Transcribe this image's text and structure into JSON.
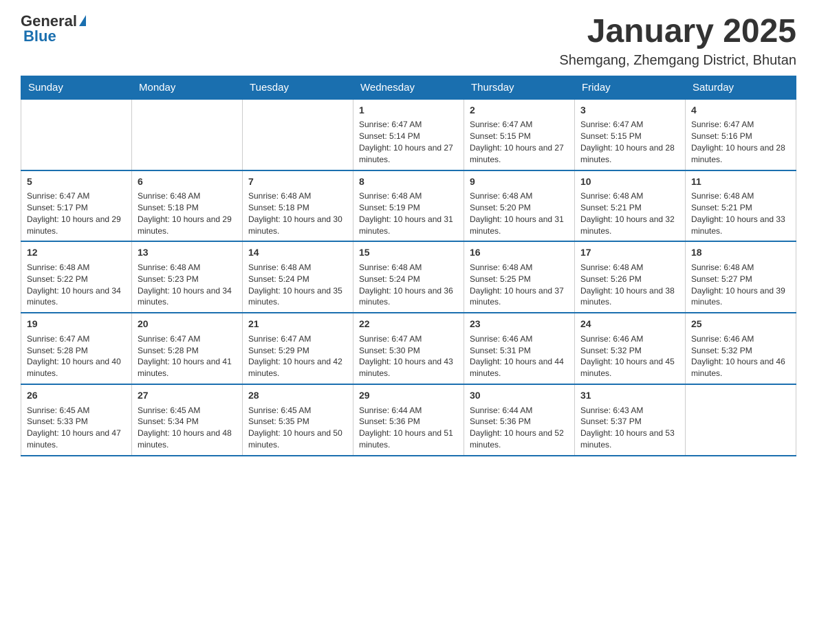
{
  "logo": {
    "text_general": "General",
    "text_blue": "Blue"
  },
  "title": "January 2025",
  "subtitle": "Shemgang, Zhemgang District, Bhutan",
  "days_of_week": [
    "Sunday",
    "Monday",
    "Tuesday",
    "Wednesday",
    "Thursday",
    "Friday",
    "Saturday"
  ],
  "weeks": [
    [
      {
        "day": "",
        "info": ""
      },
      {
        "day": "",
        "info": ""
      },
      {
        "day": "",
        "info": ""
      },
      {
        "day": "1",
        "info": "Sunrise: 6:47 AM\nSunset: 5:14 PM\nDaylight: 10 hours and 27 minutes."
      },
      {
        "day": "2",
        "info": "Sunrise: 6:47 AM\nSunset: 5:15 PM\nDaylight: 10 hours and 27 minutes."
      },
      {
        "day": "3",
        "info": "Sunrise: 6:47 AM\nSunset: 5:15 PM\nDaylight: 10 hours and 28 minutes."
      },
      {
        "day": "4",
        "info": "Sunrise: 6:47 AM\nSunset: 5:16 PM\nDaylight: 10 hours and 28 minutes."
      }
    ],
    [
      {
        "day": "5",
        "info": "Sunrise: 6:47 AM\nSunset: 5:17 PM\nDaylight: 10 hours and 29 minutes."
      },
      {
        "day": "6",
        "info": "Sunrise: 6:48 AM\nSunset: 5:18 PM\nDaylight: 10 hours and 29 minutes."
      },
      {
        "day": "7",
        "info": "Sunrise: 6:48 AM\nSunset: 5:18 PM\nDaylight: 10 hours and 30 minutes."
      },
      {
        "day": "8",
        "info": "Sunrise: 6:48 AM\nSunset: 5:19 PM\nDaylight: 10 hours and 31 minutes."
      },
      {
        "day": "9",
        "info": "Sunrise: 6:48 AM\nSunset: 5:20 PM\nDaylight: 10 hours and 31 minutes."
      },
      {
        "day": "10",
        "info": "Sunrise: 6:48 AM\nSunset: 5:21 PM\nDaylight: 10 hours and 32 minutes."
      },
      {
        "day": "11",
        "info": "Sunrise: 6:48 AM\nSunset: 5:21 PM\nDaylight: 10 hours and 33 minutes."
      }
    ],
    [
      {
        "day": "12",
        "info": "Sunrise: 6:48 AM\nSunset: 5:22 PM\nDaylight: 10 hours and 34 minutes."
      },
      {
        "day": "13",
        "info": "Sunrise: 6:48 AM\nSunset: 5:23 PM\nDaylight: 10 hours and 34 minutes."
      },
      {
        "day": "14",
        "info": "Sunrise: 6:48 AM\nSunset: 5:24 PM\nDaylight: 10 hours and 35 minutes."
      },
      {
        "day": "15",
        "info": "Sunrise: 6:48 AM\nSunset: 5:24 PM\nDaylight: 10 hours and 36 minutes."
      },
      {
        "day": "16",
        "info": "Sunrise: 6:48 AM\nSunset: 5:25 PM\nDaylight: 10 hours and 37 minutes."
      },
      {
        "day": "17",
        "info": "Sunrise: 6:48 AM\nSunset: 5:26 PM\nDaylight: 10 hours and 38 minutes."
      },
      {
        "day": "18",
        "info": "Sunrise: 6:48 AM\nSunset: 5:27 PM\nDaylight: 10 hours and 39 minutes."
      }
    ],
    [
      {
        "day": "19",
        "info": "Sunrise: 6:47 AM\nSunset: 5:28 PM\nDaylight: 10 hours and 40 minutes."
      },
      {
        "day": "20",
        "info": "Sunrise: 6:47 AM\nSunset: 5:28 PM\nDaylight: 10 hours and 41 minutes."
      },
      {
        "day": "21",
        "info": "Sunrise: 6:47 AM\nSunset: 5:29 PM\nDaylight: 10 hours and 42 minutes."
      },
      {
        "day": "22",
        "info": "Sunrise: 6:47 AM\nSunset: 5:30 PM\nDaylight: 10 hours and 43 minutes."
      },
      {
        "day": "23",
        "info": "Sunrise: 6:46 AM\nSunset: 5:31 PM\nDaylight: 10 hours and 44 minutes."
      },
      {
        "day": "24",
        "info": "Sunrise: 6:46 AM\nSunset: 5:32 PM\nDaylight: 10 hours and 45 minutes."
      },
      {
        "day": "25",
        "info": "Sunrise: 6:46 AM\nSunset: 5:32 PM\nDaylight: 10 hours and 46 minutes."
      }
    ],
    [
      {
        "day": "26",
        "info": "Sunrise: 6:45 AM\nSunset: 5:33 PM\nDaylight: 10 hours and 47 minutes."
      },
      {
        "day": "27",
        "info": "Sunrise: 6:45 AM\nSunset: 5:34 PM\nDaylight: 10 hours and 48 minutes."
      },
      {
        "day": "28",
        "info": "Sunrise: 6:45 AM\nSunset: 5:35 PM\nDaylight: 10 hours and 50 minutes."
      },
      {
        "day": "29",
        "info": "Sunrise: 6:44 AM\nSunset: 5:36 PM\nDaylight: 10 hours and 51 minutes."
      },
      {
        "day": "30",
        "info": "Sunrise: 6:44 AM\nSunset: 5:36 PM\nDaylight: 10 hours and 52 minutes."
      },
      {
        "day": "31",
        "info": "Sunrise: 6:43 AM\nSunset: 5:37 PM\nDaylight: 10 hours and 53 minutes."
      },
      {
        "day": "",
        "info": ""
      }
    ]
  ]
}
